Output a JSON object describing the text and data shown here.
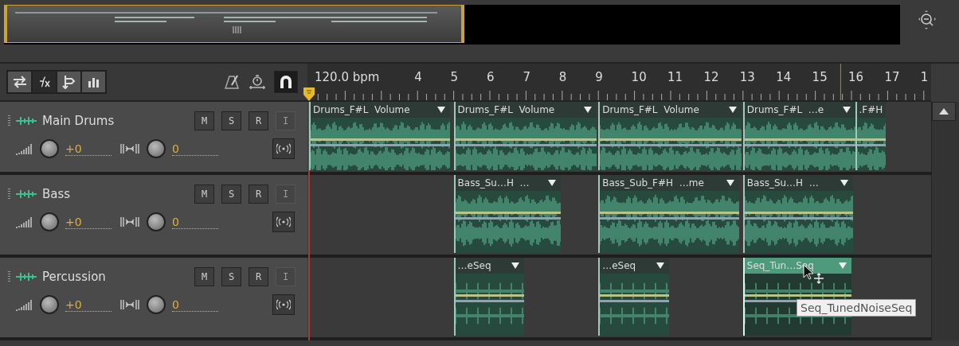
{
  "ruler": {
    "tempo": "120.0 bpm",
    "bars": [
      "4",
      "5",
      "6",
      "7",
      "8",
      "9",
      "10",
      "11",
      "12",
      "13",
      "14",
      "15",
      "16",
      "17",
      "1"
    ]
  },
  "tracks": [
    {
      "name": "Main Drums",
      "buttons": [
        {
          "label": "M",
          "disabled": false
        },
        {
          "label": "S",
          "disabled": false
        },
        {
          "label": "R",
          "disabled": false
        },
        {
          "label": "I",
          "disabled": true
        }
      ],
      "volume": "+0",
      "pan": "0",
      "kind": "audio",
      "clips": [
        {
          "label": "Drums_F#L  Volume",
          "selected": false
        },
        {
          "label": "Drums_F#L  Volume",
          "selected": false
        },
        {
          "label": "Drums_F#L  Volume",
          "selected": false
        },
        {
          "label": "Drums_F#L  …e",
          "selected": false
        },
        {
          "label": ".F#H",
          "selected": false
        }
      ]
    },
    {
      "name": "Bass",
      "buttons": [
        {
          "label": "M",
          "disabled": false
        },
        {
          "label": "S",
          "disabled": false
        },
        {
          "label": "R",
          "disabled": false
        },
        {
          "label": "I",
          "disabled": true
        }
      ],
      "volume": "+0",
      "pan": "0",
      "kind": "audio",
      "clips": [
        {
          "label": "Bass_Su…H  …",
          "selected": false
        },
        {
          "label": "Bass_Sub_F#H  …me",
          "selected": false
        },
        {
          "label": "Bass_Su…H  …",
          "selected": false
        }
      ]
    },
    {
      "name": "Percussion",
      "buttons": [
        {
          "label": "M",
          "disabled": false
        },
        {
          "label": "S",
          "disabled": false
        },
        {
          "label": "R",
          "disabled": false
        },
        {
          "label": "I",
          "disabled": true
        }
      ],
      "volume": "+0",
      "pan": "0",
      "kind": "sequence",
      "clips": [
        {
          "label": "…eSeq",
          "selected": false
        },
        {
          "label": "…eSeq",
          "selected": false
        },
        {
          "label": "Seq_Tun…Seq",
          "selected": true
        }
      ]
    }
  ],
  "tooltip": "Seq_TunedNoiseSeq"
}
